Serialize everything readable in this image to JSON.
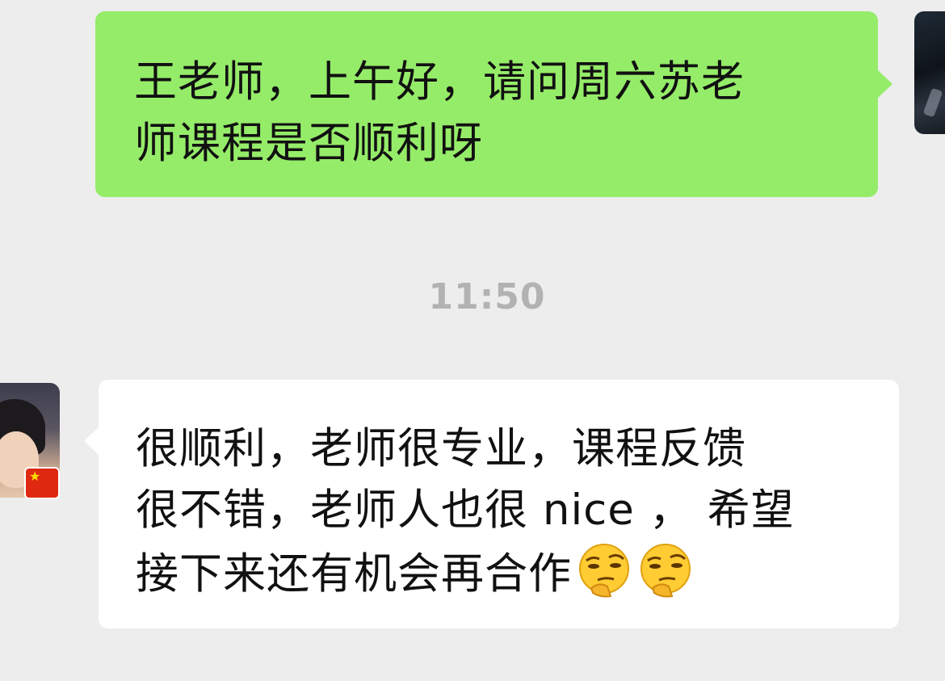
{
  "messages": [
    {
      "direction": "sent",
      "lines": [
        "王老师，上午好，请问周六苏老",
        "师课程是否顺利呀"
      ],
      "bubble_color": "#95ec69"
    },
    {
      "direction": "received",
      "lines": [
        "很顺利，老师很专业，课程反馈",
        "很不错，老师人也很 nice ， 希望",
        "接下来还有机会再合作"
      ],
      "emojis": [
        "thinking-smirk-emoji",
        "thinking-smirk-emoji"
      ],
      "bubble_color": "#ffffff",
      "sender_badge": "china-flag-icon"
    }
  ],
  "timestamp": "11:50",
  "theme": {
    "background": "#ededed",
    "timestamp_color": "#b2b2b2"
  }
}
